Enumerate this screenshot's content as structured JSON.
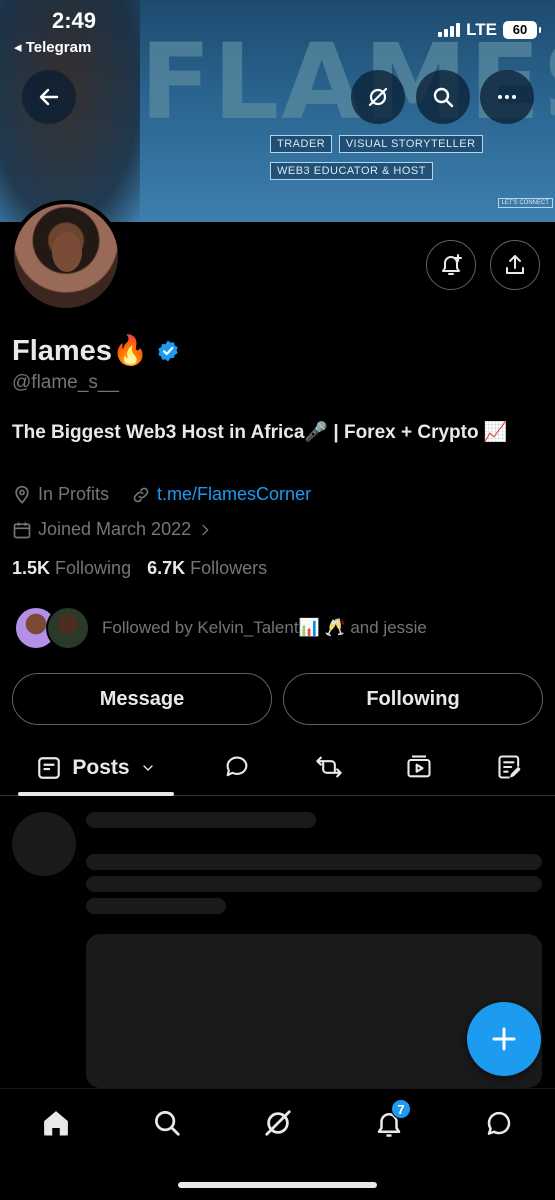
{
  "status_bar": {
    "time": "2:49",
    "back_app": "◂ Telegram",
    "network": "LTE",
    "battery": "60"
  },
  "banner": {
    "word": "FLAMES",
    "tags": [
      "TRADER",
      "VISUAL STORYTELLER",
      "WEB3 EDUCATOR & HOST"
    ],
    "small_text": "LET'S CONNECT"
  },
  "header_actions": {
    "back_icon": "arrow-left-icon",
    "grok_icon": "slash-circle-icon",
    "search_icon": "search-icon",
    "more_icon": "more-horizontal-icon"
  },
  "profile": {
    "name": "Flames🔥",
    "verified": true,
    "handle": "@flame_s__",
    "bio": "The Biggest Web3 Host in Africa🎤 | Forex + Crypto 📈",
    "location": "In Profits",
    "website": "t.me/FlamesCorner",
    "joined": "Joined March 2022",
    "following_count": "1.5K",
    "following_label": "Following",
    "followers_count": "6.7K",
    "followers_label": "Followers",
    "followed_by": "Followed by Kelvin_Talent📊 🥂 and jessie"
  },
  "actions": {
    "notify_icon": "bell-plus-icon",
    "share_icon": "share-icon",
    "message_label": "Message",
    "following_label": "Following"
  },
  "tabs": {
    "posts_label": "Posts",
    "icons": [
      "replies-icon",
      "reposts-icon",
      "media-icon",
      "articles-icon"
    ]
  },
  "bottom_nav": {
    "items": [
      "home-icon",
      "search-icon",
      "grok-icon",
      "notifications-icon",
      "messages-icon"
    ],
    "notifications_badge": "7"
  },
  "colors": {
    "accent": "#1d9bf0",
    "text": "#e7e9ea",
    "muted": "#71767b",
    "border": "#536471"
  }
}
